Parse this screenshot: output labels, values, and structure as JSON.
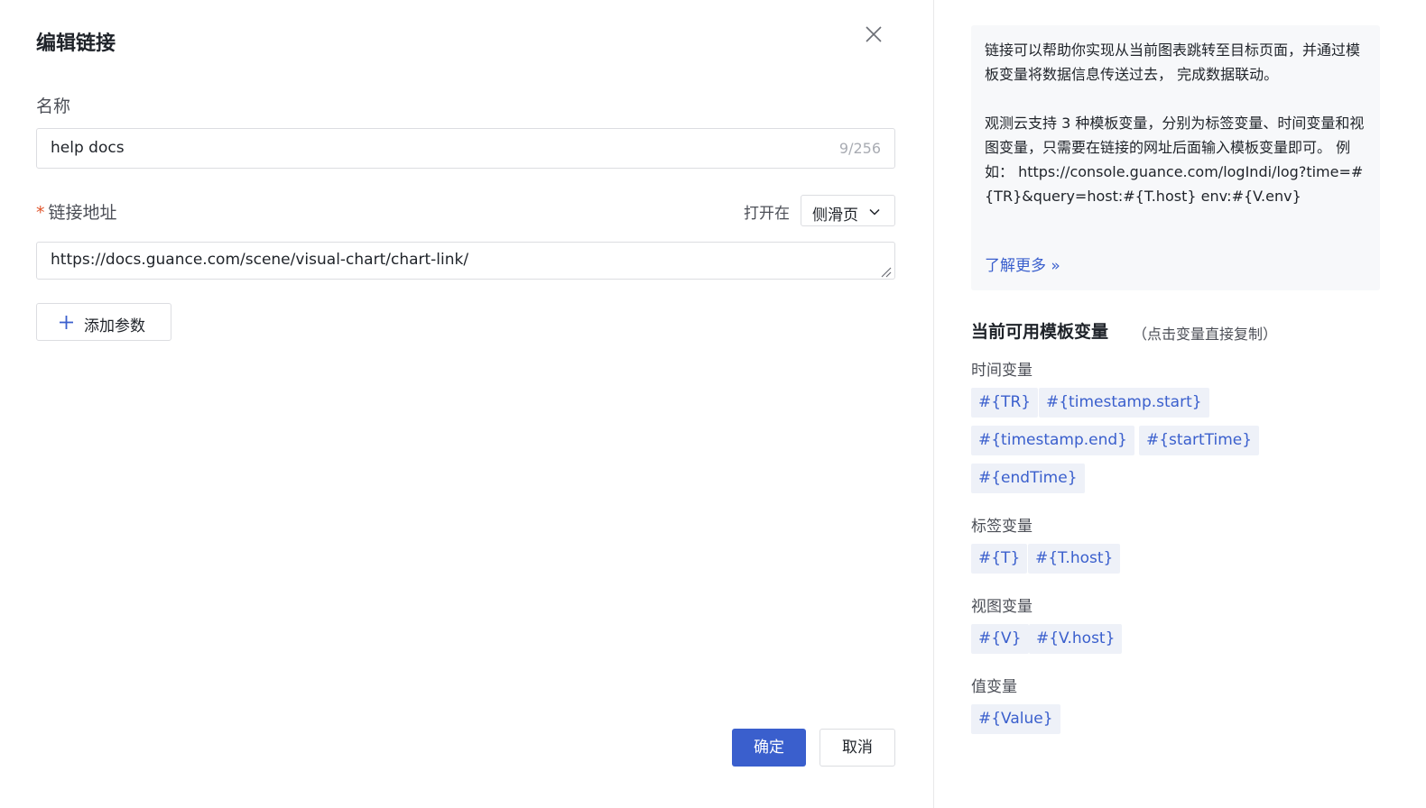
{
  "dialog": {
    "title": "编辑链接",
    "name_label": "名称",
    "name_value": "help docs",
    "name_count": "9/256",
    "url_required": "*",
    "url_label": "链接地址",
    "open_in_label": "打开在",
    "open_in_value": "侧滑页",
    "url_value": "https://docs.guance.com/scene/visual-chart/chart-link/",
    "add_param_label": "添加参数",
    "ok_label": "确定",
    "cancel_label": "取消"
  },
  "help": {
    "p1": "链接可以帮助你实现从当前图表跳转至目标页面，并通过模板变量将数据信息传送过去， 完成数据联动。",
    "p2": "观测云支持 3 种模板变量，分别为标签变量、时间变量和视图变量，只需要在链接的网址后面输入模板变量即可。 例如： https://console.guance.com/logIndi/log?time=#{TR}&query=host:#{T.host} env:#{V.env}",
    "learn_more": "了解更多 »"
  },
  "vars": {
    "title": "当前可用模板变量",
    "hint": "（点击变量直接复制）",
    "groups": [
      {
        "label": "时间变量",
        "tags": [
          "#{TR}",
          "#{timestamp.start}",
          "#{timestamp.end}",
          "#{startTime}",
          "#{endTime}"
        ]
      },
      {
        "label": "标签变量",
        "tags": [
          "#{T}",
          "#{T.host}"
        ]
      },
      {
        "label": "视图变量",
        "tags": [
          "#{V}",
          "#{V.host}"
        ]
      },
      {
        "label": "值变量",
        "tags": [
          "#{Value}"
        ]
      }
    ]
  },
  "colors": {
    "primary": "#3a5fcd",
    "required": "#e0552c",
    "tag_bg": "#eef1f8",
    "help_bg": "#f7f8fa"
  },
  "icons": [
    "close-icon",
    "chevron-down-icon",
    "resize-handle-icon",
    "plus-icon"
  ]
}
